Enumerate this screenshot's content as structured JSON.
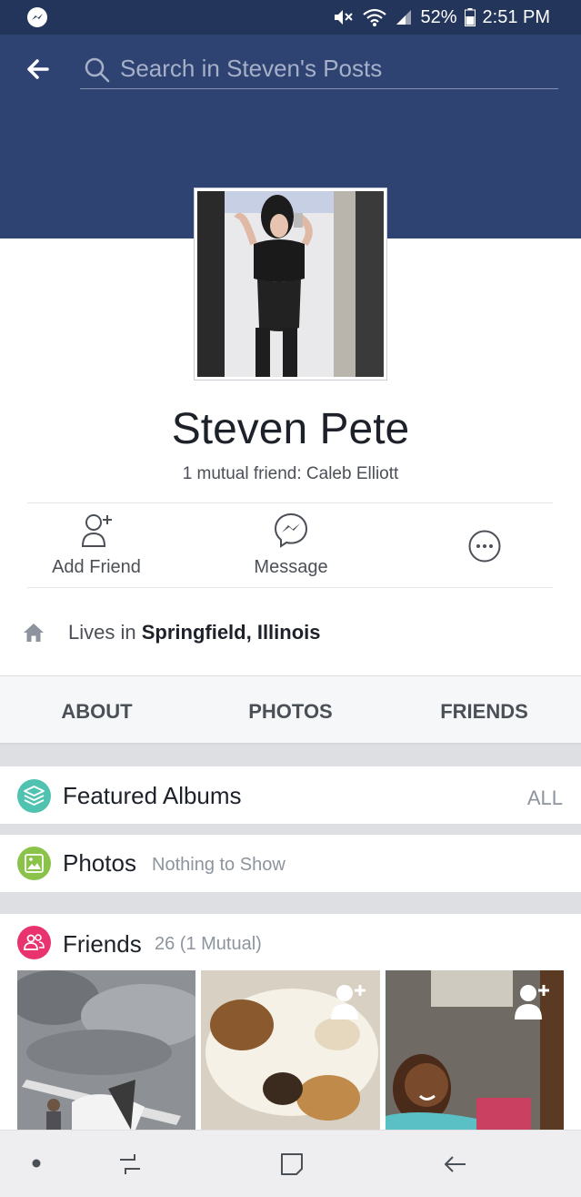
{
  "status_bar": {
    "battery": "52%",
    "time": "2:51 PM"
  },
  "header": {
    "search_placeholder": "Search in Steven's Posts"
  },
  "profile": {
    "name": "Steven Pete",
    "mutual_friends": "1 mutual friend: Caleb Elliott",
    "lives_prefix": "Lives in ",
    "lives_location": "Springfield, Illinois"
  },
  "actions": {
    "add_friend": "Add Friend",
    "message": "Message"
  },
  "tabs": [
    "ABOUT",
    "PHOTOS",
    "FRIENDS"
  ],
  "sections": {
    "featured_albums": {
      "title": "Featured Albums",
      "link": "ALL"
    },
    "photos": {
      "title": "Photos",
      "subtitle": "Nothing to Show"
    },
    "friends": {
      "title": "Friends",
      "subtitle": "26 (1 Mutual)"
    }
  },
  "colors": {
    "header": "#2e4372",
    "status_bar": "#23355a",
    "albums_icon": "#4fc2b0",
    "photos_icon": "#8bc34a",
    "friends_icon": "#e8336f"
  },
  "icons": [
    "messenger-notification-icon",
    "mute-icon",
    "wifi-icon",
    "signal-icon",
    "battery-icon",
    "back-arrow-icon",
    "search-icon",
    "add-friend-icon",
    "messenger-icon",
    "more-icon",
    "home-icon",
    "albums-icon",
    "photos-icon",
    "friends-icon",
    "recent-apps-icon",
    "home-button-icon",
    "back-icon"
  ]
}
